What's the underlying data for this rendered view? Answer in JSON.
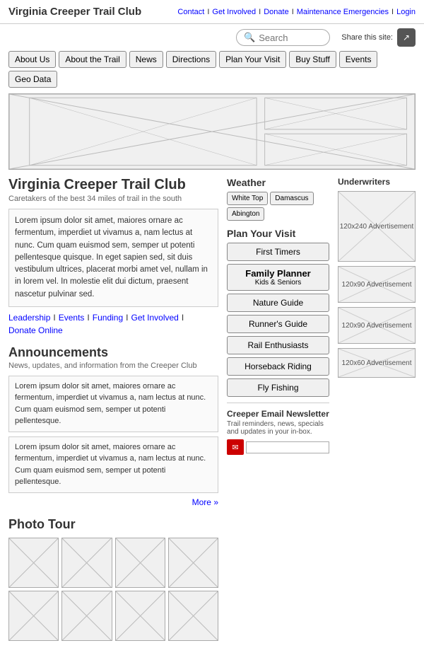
{
  "header": {
    "site_title": "Virginia Creeper Trail Club",
    "nav_links": [
      "Contact",
      "Get Involved",
      "Donate",
      "Maintenance Emergencies",
      "Login"
    ],
    "search_placeholder": "Search",
    "search_label": "Search",
    "share_label": "Share this site:"
  },
  "nav": {
    "items": [
      "About Us",
      "About the Trail",
      "News",
      "Directions",
      "Plan Your Visit",
      "Buy Stuff",
      "Events",
      "Geo Data"
    ]
  },
  "left": {
    "heading": "Virginia Creeper Trail Club",
    "subheading": "Caretakers of the best 34 miles of trail in the south",
    "intro": "Lorem ipsum dolor sit amet, maiores ornare ac fermentum, imperdiet ut vivamus a, nam lectus at nunc. Cum quam euismod sem, semper ut potenti pellentesque quisque. In eget sapien sed, sit duis vestibulum ultrices, placerat morbi amet vel, nullam in in lorem vel. In molestie elit dui dictum, praesent nascetur pulvinar sed.",
    "links": [
      "Leadership",
      "Events",
      "Funding",
      "Get Involved",
      "Donate Online"
    ],
    "announcements_heading": "Announcements",
    "announcements_sub": "News, updates, and information from the Creeper Club",
    "announce1": "Lorem ipsum dolor sit amet, maiores ornare ac fermentum, imperdiet ut vivamus a, nam lectus at nunc. Cum quam euismod sem, semper ut potenti pellentesque.",
    "announce2": "Lorem ipsum dolor sit amet, maiores ornare ac fermentum, imperdiet ut vivamus a, nam lectus at nunc. Cum quam euismod sem, semper ut potenti pellentesque.",
    "more_label": "More »",
    "photo_tour_heading": "Photo Tour"
  },
  "weather": {
    "title": "Weather",
    "tabs": [
      "White Top",
      "Damascus",
      "Abington"
    ]
  },
  "plan": {
    "title": "Plan Your Visit",
    "items": [
      {
        "label": "First Timers",
        "sub": "",
        "featured": false
      },
      {
        "label": "Family Planner",
        "sub": "Kids & Seniors",
        "featured": true
      },
      {
        "label": "Nature Guide",
        "sub": "",
        "featured": false
      },
      {
        "label": "Runner's Guide",
        "sub": "",
        "featured": false
      },
      {
        "label": "Rail Enthusiasts",
        "sub": "",
        "featured": false
      },
      {
        "label": "Horseback Riding",
        "sub": "",
        "featured": false
      },
      {
        "label": "Fly Fishing",
        "sub": "",
        "featured": false
      }
    ]
  },
  "newsletter": {
    "title": "Creeper Email Newsletter",
    "desc": "Trail reminders, news, specials and updates in your in-box.",
    "placeholder": ""
  },
  "underwriters": {
    "title": "Underwriters",
    "ads": [
      {
        "size": "120x240",
        "label": "120x240\nAdvertisement"
      },
      {
        "size": "120x90",
        "label": "120x90\nAdvertisement"
      },
      {
        "size": "120x90",
        "label": "120x90\nAdvertisement"
      },
      {
        "size": "120x60",
        "label": "120x60\nAdvertisement"
      }
    ]
  }
}
